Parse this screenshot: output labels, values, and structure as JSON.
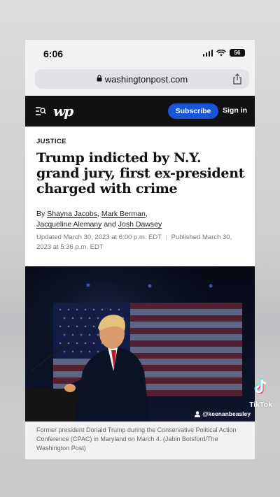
{
  "status_bar": {
    "time": "6:06",
    "battery": "56"
  },
  "browser": {
    "url": "washingtonpost.com"
  },
  "header": {
    "logo": "wp",
    "subscribe_label": "Subscribe",
    "signin_label": "Sign in"
  },
  "article": {
    "kicker": "JUSTICE",
    "headline": "Trump indicted by N.Y. grand jury, first ex-president charged with crime",
    "byline_prefix": "By",
    "authors": [
      "Shayna Jacobs",
      "Mark Berman",
      "Jacqueline Alemany",
      "Josh Dawsey"
    ],
    "byline_and": "and",
    "updated": "Updated March 30, 2023 at 6:00 p.m. EDT",
    "separator": "|",
    "published": "Published March 30, 2023 at 5:36 p.m. EDT",
    "caption": "Former president Donald Trump during the Conservative Political Action Conference (CPAC) in Maryland on March 4. (Jabin Botsford/The Washington Post)"
  },
  "overlay": {
    "tiktok_label": "TikTok",
    "tiktok_user": "@keenanbeasley"
  },
  "colors": {
    "header_bg": "#111111",
    "subscribe_bg": "#1955d8",
    "photo_bg": "#0c1020"
  },
  "icons": [
    "lock-icon",
    "share-icon",
    "menu-search-icon",
    "person-icon",
    "tiktok-icon",
    "signal-icon",
    "wifi-icon",
    "battery-icon"
  ]
}
